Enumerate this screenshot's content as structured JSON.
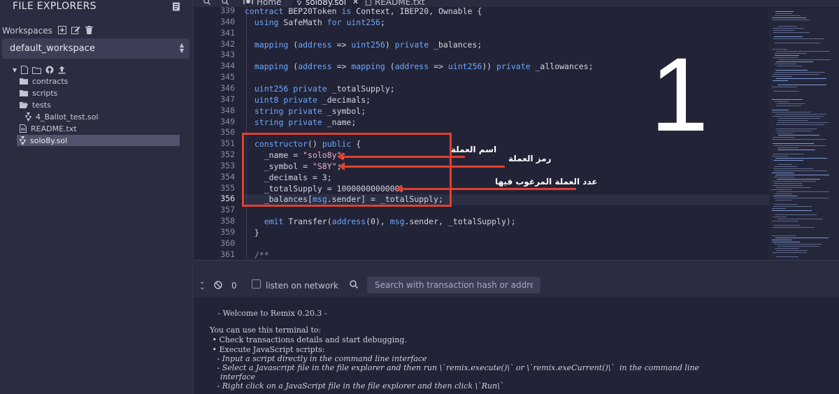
{
  "sidebar": {
    "title": "FILE EXPLORERS",
    "workspaces_label": "Workspaces",
    "workspace_selected": "default_workspace",
    "tree": [
      {
        "type": "folder",
        "label": "contracts"
      },
      {
        "type": "folder",
        "label": "scripts"
      },
      {
        "type": "folder",
        "label": "tests"
      },
      {
        "type": "file",
        "label": "4_Ballot_test.sol",
        "icon": "solidity-icon"
      },
      {
        "type": "file",
        "label": "README.txt",
        "icon": "file-icon"
      },
      {
        "type": "file",
        "label": "solo8y.sol",
        "icon": "solidity-icon",
        "selected": true
      }
    ]
  },
  "tabs": [
    {
      "label": "Home",
      "icon": "remix-logo-icon"
    },
    {
      "label": "solo8y.sol",
      "icon": "solidity-icon",
      "active": true
    },
    {
      "label": "README.txt",
      "icon": "file-icon"
    }
  ],
  "editor": {
    "active_line": "356",
    "lines": [
      {
        "n": "339",
        "text": "contract BEP20Token is Context, IBEP20, Ownable {"
      },
      {
        "n": "340",
        "text": "  using SafeMath for uint256;"
      },
      {
        "n": "341",
        "text": ""
      },
      {
        "n": "342",
        "text": "  mapping (address => uint256) private _balances;"
      },
      {
        "n": "343",
        "text": ""
      },
      {
        "n": "344",
        "text": "  mapping (address => mapping (address => uint256)) private _allowances;"
      },
      {
        "n": "345",
        "text": ""
      },
      {
        "n": "346",
        "text": "  uint256 private _totalSupply;"
      },
      {
        "n": "347",
        "text": "  uint8 private _decimals;"
      },
      {
        "n": "348",
        "text": "  string private _symbol;"
      },
      {
        "n": "349",
        "text": "  string private _name;"
      },
      {
        "n": "350",
        "text": ""
      },
      {
        "n": "351",
        "text": "  constructor() public {"
      },
      {
        "n": "352",
        "text": "    _name = \"solo8y\";"
      },
      {
        "n": "353",
        "text": "    _symbol = \"S8Y\";"
      },
      {
        "n": "354",
        "text": "    _decimals = 3;"
      },
      {
        "n": "355",
        "text": "    _totalSupply = 1000000000000;"
      },
      {
        "n": "356",
        "text": "    _balances[msg.sender] = _totalSupply;"
      },
      {
        "n": "357",
        "text": ""
      },
      {
        "n": "358",
        "text": "    emit Transfer(address(0), msg.sender, _totalSupply);"
      },
      {
        "n": "359",
        "text": "  }"
      },
      {
        "n": "360",
        "text": ""
      },
      {
        "n": "361",
        "text": "  /**"
      }
    ]
  },
  "annotations": {
    "name_label": "اسم العملة",
    "symbol_label": "رمز العملة",
    "supply_label": "عدد العملة المرغوب فيها",
    "big_number": "1",
    "color": "#e1402f"
  },
  "terminal": {
    "pending_count": "0",
    "listen_label": "listen on network",
    "search_placeholder": "Search with transaction hash or address",
    "lines": [
      " - Welcome to Remix 0.20.3 -",
      "",
      "You can use this terminal to:",
      " • Check transactions details and start debugging.",
      " • Execute JavaScript scripts:",
      "   - Input a script directly in the command line interface",
      "   - Select a Javascript file in the file explorer and then run \\`remix.execute()\\` or \\`remix.exeCurrent()\\`  in the command line",
      "  interface",
      "   - Right click on a JavaScript file in the file explorer and then click \\`Run\\`"
    ]
  },
  "colors": {
    "background": "#222336",
    "panel": "#2a2c3f",
    "keyword": "#6ea8ff",
    "string": "#f0b4ce"
  }
}
